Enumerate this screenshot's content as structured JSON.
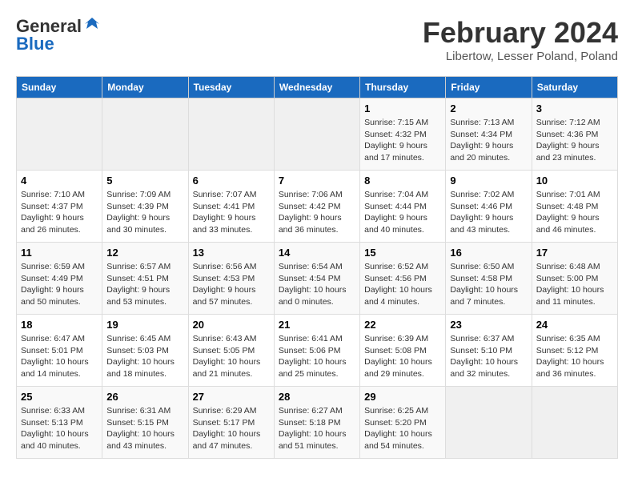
{
  "header": {
    "logo_general": "General",
    "logo_blue": "Blue",
    "month": "February 2024",
    "location": "Libertow, Lesser Poland, Poland"
  },
  "days_of_week": [
    "Sunday",
    "Monday",
    "Tuesday",
    "Wednesday",
    "Thursday",
    "Friday",
    "Saturday"
  ],
  "weeks": [
    [
      {
        "day": "",
        "content": ""
      },
      {
        "day": "",
        "content": ""
      },
      {
        "day": "",
        "content": ""
      },
      {
        "day": "",
        "content": ""
      },
      {
        "day": "1",
        "content": "Sunrise: 7:15 AM\nSunset: 4:32 PM\nDaylight: 9 hours\nand 17 minutes."
      },
      {
        "day": "2",
        "content": "Sunrise: 7:13 AM\nSunset: 4:34 PM\nDaylight: 9 hours\nand 20 minutes."
      },
      {
        "day": "3",
        "content": "Sunrise: 7:12 AM\nSunset: 4:36 PM\nDaylight: 9 hours\nand 23 minutes."
      }
    ],
    [
      {
        "day": "4",
        "content": "Sunrise: 7:10 AM\nSunset: 4:37 PM\nDaylight: 9 hours\nand 26 minutes."
      },
      {
        "day": "5",
        "content": "Sunrise: 7:09 AM\nSunset: 4:39 PM\nDaylight: 9 hours\nand 30 minutes."
      },
      {
        "day": "6",
        "content": "Sunrise: 7:07 AM\nSunset: 4:41 PM\nDaylight: 9 hours\nand 33 minutes."
      },
      {
        "day": "7",
        "content": "Sunrise: 7:06 AM\nSunset: 4:42 PM\nDaylight: 9 hours\nand 36 minutes."
      },
      {
        "day": "8",
        "content": "Sunrise: 7:04 AM\nSunset: 4:44 PM\nDaylight: 9 hours\nand 40 minutes."
      },
      {
        "day": "9",
        "content": "Sunrise: 7:02 AM\nSunset: 4:46 PM\nDaylight: 9 hours\nand 43 minutes."
      },
      {
        "day": "10",
        "content": "Sunrise: 7:01 AM\nSunset: 4:48 PM\nDaylight: 9 hours\nand 46 minutes."
      }
    ],
    [
      {
        "day": "11",
        "content": "Sunrise: 6:59 AM\nSunset: 4:49 PM\nDaylight: 9 hours\nand 50 minutes."
      },
      {
        "day": "12",
        "content": "Sunrise: 6:57 AM\nSunset: 4:51 PM\nDaylight: 9 hours\nand 53 minutes."
      },
      {
        "day": "13",
        "content": "Sunrise: 6:56 AM\nSunset: 4:53 PM\nDaylight: 9 hours\nand 57 minutes."
      },
      {
        "day": "14",
        "content": "Sunrise: 6:54 AM\nSunset: 4:54 PM\nDaylight: 10 hours\nand 0 minutes."
      },
      {
        "day": "15",
        "content": "Sunrise: 6:52 AM\nSunset: 4:56 PM\nDaylight: 10 hours\nand 4 minutes."
      },
      {
        "day": "16",
        "content": "Sunrise: 6:50 AM\nSunset: 4:58 PM\nDaylight: 10 hours\nand 7 minutes."
      },
      {
        "day": "17",
        "content": "Sunrise: 6:48 AM\nSunset: 5:00 PM\nDaylight: 10 hours\nand 11 minutes."
      }
    ],
    [
      {
        "day": "18",
        "content": "Sunrise: 6:47 AM\nSunset: 5:01 PM\nDaylight: 10 hours\nand 14 minutes."
      },
      {
        "day": "19",
        "content": "Sunrise: 6:45 AM\nSunset: 5:03 PM\nDaylight: 10 hours\nand 18 minutes."
      },
      {
        "day": "20",
        "content": "Sunrise: 6:43 AM\nSunset: 5:05 PM\nDaylight: 10 hours\nand 21 minutes."
      },
      {
        "day": "21",
        "content": "Sunrise: 6:41 AM\nSunset: 5:06 PM\nDaylight: 10 hours\nand 25 minutes."
      },
      {
        "day": "22",
        "content": "Sunrise: 6:39 AM\nSunset: 5:08 PM\nDaylight: 10 hours\nand 29 minutes."
      },
      {
        "day": "23",
        "content": "Sunrise: 6:37 AM\nSunset: 5:10 PM\nDaylight: 10 hours\nand 32 minutes."
      },
      {
        "day": "24",
        "content": "Sunrise: 6:35 AM\nSunset: 5:12 PM\nDaylight: 10 hours\nand 36 minutes."
      }
    ],
    [
      {
        "day": "25",
        "content": "Sunrise: 6:33 AM\nSunset: 5:13 PM\nDaylight: 10 hours\nand 40 minutes."
      },
      {
        "day": "26",
        "content": "Sunrise: 6:31 AM\nSunset: 5:15 PM\nDaylight: 10 hours\nand 43 minutes."
      },
      {
        "day": "27",
        "content": "Sunrise: 6:29 AM\nSunset: 5:17 PM\nDaylight: 10 hours\nand 47 minutes."
      },
      {
        "day": "28",
        "content": "Sunrise: 6:27 AM\nSunset: 5:18 PM\nDaylight: 10 hours\nand 51 minutes."
      },
      {
        "day": "29",
        "content": "Sunrise: 6:25 AM\nSunset: 5:20 PM\nDaylight: 10 hours\nand 54 minutes."
      },
      {
        "day": "",
        "content": ""
      },
      {
        "day": "",
        "content": ""
      }
    ]
  ]
}
